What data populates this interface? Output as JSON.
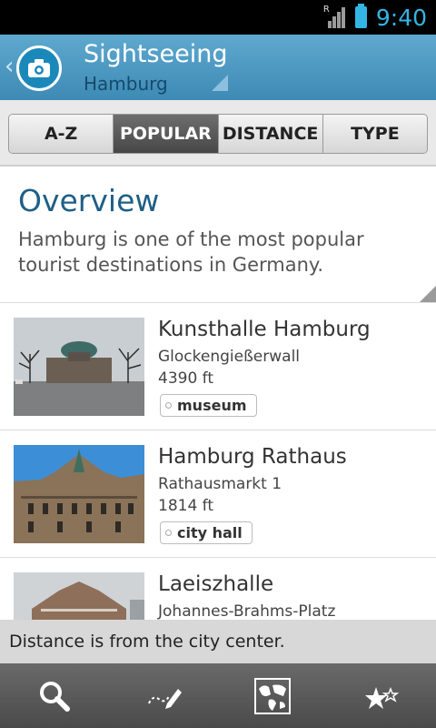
{
  "status_bar": {
    "time": "9:40",
    "network_label": "R"
  },
  "header": {
    "title": "Sightseeing",
    "subtitle": "Hamburg",
    "logo_icon": "camera-icon",
    "back_icon": "chevron-left-icon"
  },
  "tabs": [
    {
      "label": "A-Z",
      "active": false
    },
    {
      "label": "POPULAR",
      "active": true
    },
    {
      "label": "DISTANCE",
      "active": false
    },
    {
      "label": "TYPE",
      "active": false
    }
  ],
  "overview": {
    "title": "Overview",
    "text": "Hamburg is one of the most popular tourist destinations in Germany."
  },
  "places": [
    {
      "name": "Kunsthalle Hamburg",
      "address": "Glockengießerwall",
      "distance": "4390 ft",
      "tag": "museum"
    },
    {
      "name": "Hamburg Rathaus",
      "address": "Rathausmarkt 1",
      "distance": "1814 ft",
      "tag": "city hall"
    },
    {
      "name": "Laeiszhalle",
      "address": "Johannes-Brahms-Platz",
      "distance": "",
      "tag": ""
    }
  ],
  "toast": {
    "text": "Distance is from the city center."
  },
  "bottom_bar": [
    {
      "icon": "search-icon"
    },
    {
      "icon": "edit-route-icon"
    },
    {
      "icon": "map-icon"
    },
    {
      "icon": "favorites-stars-icon"
    }
  ],
  "colors": {
    "accent": "#33b5e5",
    "header": "#3d8ab5",
    "title_text": "#1f5f86"
  }
}
